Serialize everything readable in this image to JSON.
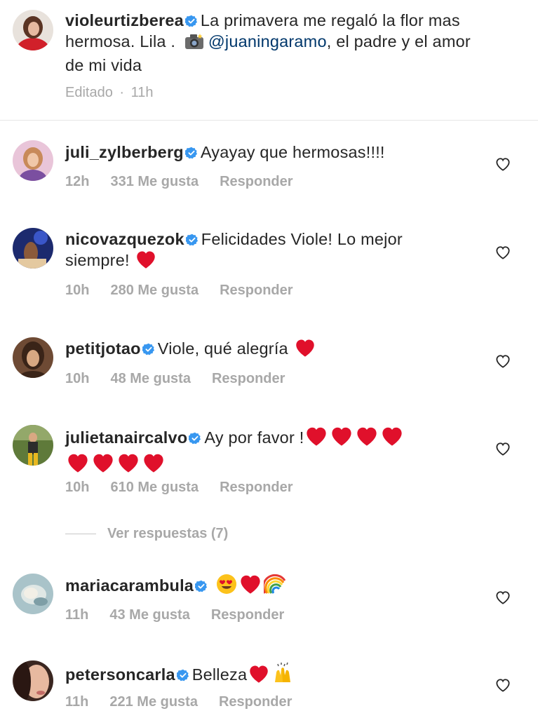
{
  "caption": {
    "username": "violeurtizberea",
    "text_part1": "La primavera me regaló la flor mas hermosa. Lila .",
    "camera_emoji": "📸",
    "mention": "@juaningaramo",
    "text_part2": ", el padre y el amor de mi vida",
    "edited_label": "Editado",
    "separator": "·",
    "time": "11h"
  },
  "comments": [
    {
      "username": "juli_zylberberg",
      "text": "Ayayay que hermosas!!!!",
      "time": "12h",
      "likes": "331 Me gusta",
      "reply": "Responder",
      "hearts_line1": 0,
      "hearts_line2": 0
    },
    {
      "username": "nicovazquezok",
      "text_line1": "Felicidades Viole! Lo mejor",
      "text_line2": "siempre!",
      "time": "10h",
      "likes": "280 Me gusta",
      "reply": "Responder"
    },
    {
      "username": "petitjotao",
      "text": "Viole, qué alegría",
      "time": "10h",
      "likes": "48 Me gusta",
      "reply": "Responder"
    },
    {
      "username": "julietanaircalvo",
      "text": "Ay por favor !",
      "time": "10h",
      "likes": "610 Me gusta",
      "reply": "Responder"
    },
    {
      "username": "mariacarambula",
      "time": "11h",
      "likes": "43 Me gusta",
      "reply": "Responder"
    },
    {
      "username": "petersoncarla",
      "text": "Belleza",
      "time": "11h",
      "likes": "221 Me gusta",
      "reply": "Responder"
    }
  ],
  "view_replies": "Ver respuestas (7)",
  "icons": {
    "verified": "verified-badge-icon",
    "like": "heart-outline-icon",
    "heart_emoji": "red-heart-emoji",
    "rainbow_emoji": "rainbow-emoji",
    "heart_eyes_emoji": "heart-eyes-emoji",
    "raised_hands_emoji": "raised-hands-emoji"
  },
  "colors": {
    "verified_blue": "#3897f0",
    "heart_red": "#e0102b",
    "meta_gray": "#a8a8a8",
    "mention_blue": "#00376b"
  }
}
